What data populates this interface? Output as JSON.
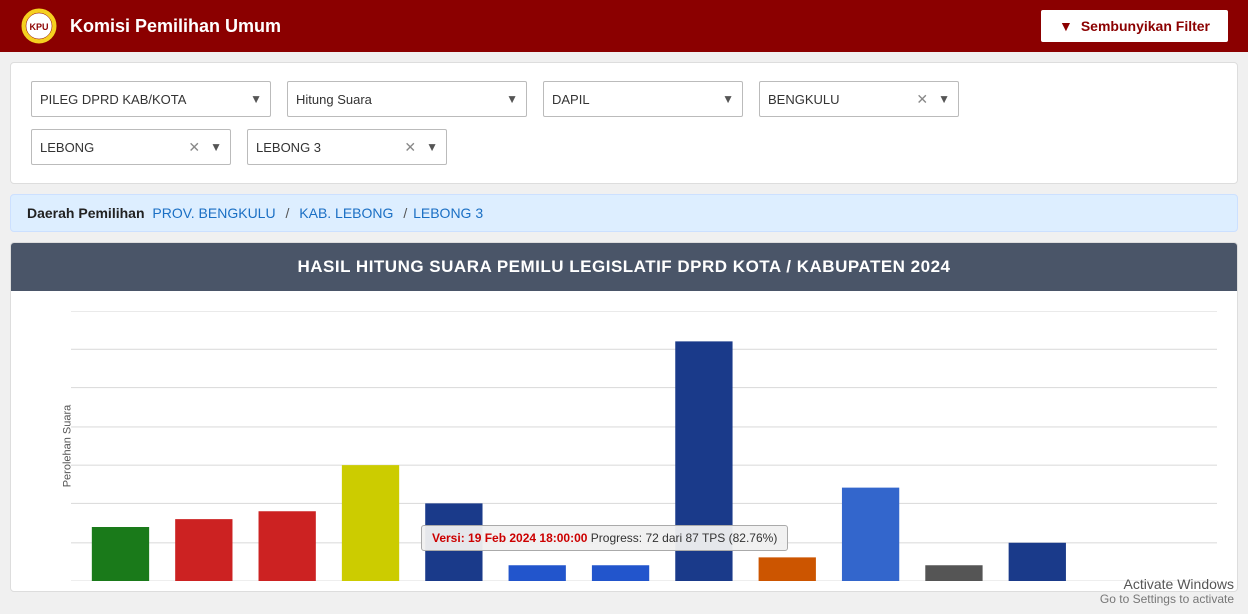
{
  "header": {
    "title": "Komisi Pemilihan Umum",
    "filter_button_label": "Sembunyikan Filter"
  },
  "filters": {
    "row1": [
      {
        "id": "jenis",
        "label": "PILEG DPRD KAB/KOTA",
        "clearable": false
      },
      {
        "id": "metode",
        "label": "Hitung Suara",
        "clearable": false
      },
      {
        "id": "dapil",
        "label": "DAPIL",
        "clearable": true
      },
      {
        "id": "provinsi",
        "label": "BENGKULU",
        "clearable": true
      }
    ],
    "row2": [
      {
        "id": "kabkota",
        "label": "LEBONG",
        "clearable": true
      },
      {
        "id": "dapil2",
        "label": "LEBONG 3",
        "clearable": true
      }
    ]
  },
  "breadcrumb": {
    "label": "Daerah Pemilihan",
    "prov": "PROV. BENGKULU",
    "kab": "KAB. LEBONG",
    "dapil": "LEBONG 3"
  },
  "chart": {
    "title": "HASIL HITUNG SUARA PEMILU LEGISLATIF DPRD KOTA / KABUPATEN 2024",
    "y_axis_label": "Perolehan Suara",
    "y_max": 35,
    "y_ticks": [
      35,
      31,
      30,
      25,
      20,
      15,
      10,
      5,
      0
    ],
    "tooltip": {
      "date_label": "Versi: 19 Feb 2024 18:00:00",
      "progress_label": "Progress: 72 dari 87 TPS (82.76%)"
    },
    "bars": [
      {
        "id": "bar1",
        "value": 7,
        "color": "#1a7a1a"
      },
      {
        "id": "bar2",
        "value": 8,
        "color": "#cc2222"
      },
      {
        "id": "bar3",
        "value": 9,
        "color": "#cc2222"
      },
      {
        "id": "bar4",
        "value": 15,
        "color": "#cccc00"
      },
      {
        "id": "bar5",
        "value": 10,
        "color": "#1a3a8a"
      },
      {
        "id": "bar6",
        "value": 2,
        "color": "#2255cc"
      },
      {
        "id": "bar7",
        "value": 2,
        "color": "#2255cc"
      },
      {
        "id": "bar8",
        "value": 31,
        "color": "#1a3a8a"
      },
      {
        "id": "bar9",
        "value": 3,
        "color": "#cc5500"
      },
      {
        "id": "bar10",
        "value": 12,
        "color": "#3366cc"
      },
      {
        "id": "bar11",
        "value": 2,
        "color": "#555555"
      },
      {
        "id": "bar12",
        "value": 5,
        "color": "#1a3a8a"
      }
    ]
  },
  "activate_windows": {
    "line1": "Activate Windows",
    "line2": "Go to Settings to activate"
  }
}
